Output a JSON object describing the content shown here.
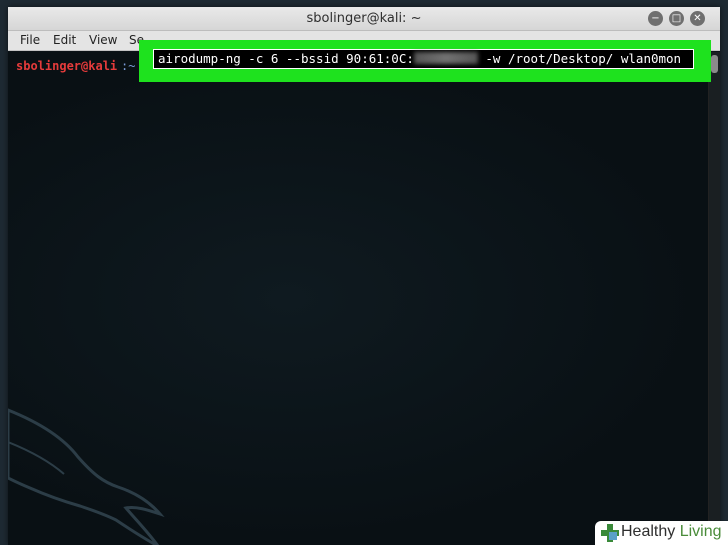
{
  "window": {
    "title": "sbolinger@kali: ~",
    "controls": {
      "minimize": "−",
      "maximize": "□",
      "close": "✕"
    }
  },
  "menu": {
    "items": [
      "File",
      "Edit",
      "View",
      "Se"
    ]
  },
  "terminal": {
    "prompt_user": "sbolinger@kali",
    "prompt_sep": ":~",
    "command_prefix": "airodump-ng -c 6 --bssid 90:61:0C:",
    "command_suffix": " -w /root/Desktop/ wlan0mon"
  },
  "colors": {
    "highlight": "#1ee21e",
    "prompt_user": "#e53b3b",
    "terminal_bg": "#0b1216"
  },
  "watermark": {
    "word1": "Healthy",
    "word2": " Living"
  }
}
